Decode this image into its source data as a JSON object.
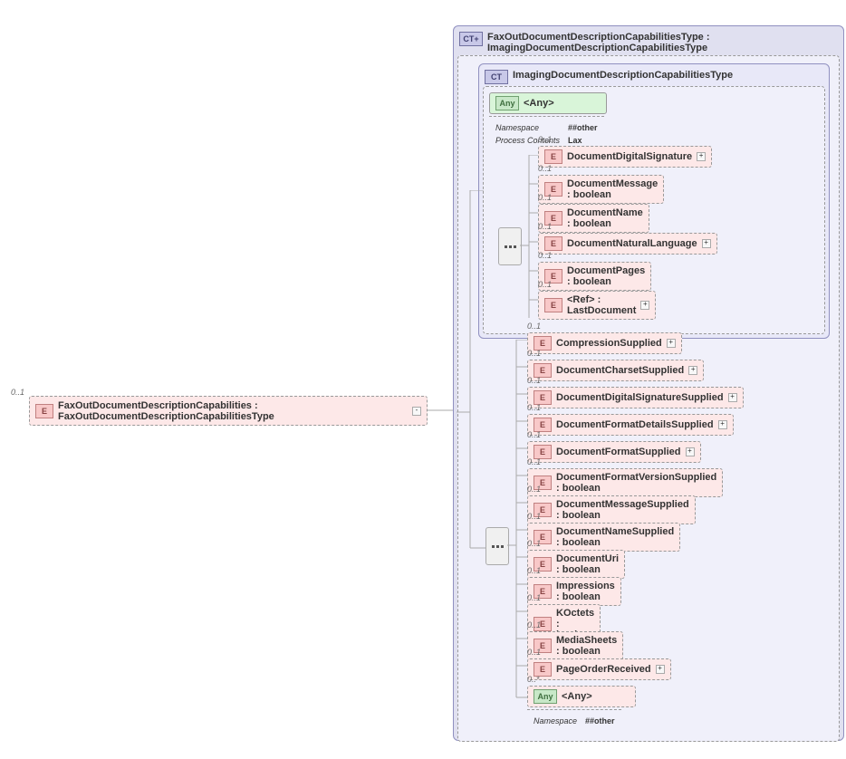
{
  "root": {
    "cardinality": "0..1",
    "element_name": "FaxOutDocumentDescriptionCapabilities",
    "element_type": "FaxOutDocumentDescriptionCapabilitiesType"
  },
  "outer_ct": {
    "name": "FaxOutDocumentDescriptionCapabilitiesType",
    "base": "ImagingDocumentDescriptionCapabilitiesType"
  },
  "inner_ct": {
    "name": "ImagingDocumentDescriptionCapabilitiesType"
  },
  "any_top": {
    "label": "<Any>",
    "namespace_label": "Namespace",
    "namespace_val": "##other",
    "process_label": "Process Contents",
    "process_val": "Lax"
  },
  "inner_elements": [
    {
      "card": "0..1",
      "label": "DocumentDigitalSignature",
      "expand": true
    },
    {
      "card": "0..1",
      "label": "DocumentMessage : boolean"
    },
    {
      "card": "0..1",
      "label": "DocumentName : boolean"
    },
    {
      "card": "0..1",
      "label": "DocumentNaturalLanguage",
      "expand": true
    },
    {
      "card": "0..1",
      "label": "DocumentPages : boolean"
    },
    {
      "card": "0..1",
      "label": "<Ref>    : LastDocument",
      "expand": true
    }
  ],
  "outer_elements": [
    {
      "card": "0..1",
      "label": "CompressionSupplied",
      "expand": true
    },
    {
      "card": "0..1",
      "label": "DocumentCharsetSupplied",
      "expand": true
    },
    {
      "card": "0..1",
      "label": "DocumentDigitalSignatureSupplied",
      "expand": true
    },
    {
      "card": "0..1",
      "label": "DocumentFormatDetailsSupplied",
      "expand": true
    },
    {
      "card": "0..1",
      "label": "DocumentFormatSupplied",
      "expand": true
    },
    {
      "card": "0..1",
      "label": "DocumentFormatVersionSupplied : boolean"
    },
    {
      "card": "0..1",
      "label": "DocumentMessageSupplied : boolean"
    },
    {
      "card": "0..1",
      "label": "DocumentNameSupplied : boolean"
    },
    {
      "card": "0..1",
      "label": "DocumentUri : boolean"
    },
    {
      "card": "0..1",
      "label": "Impressions : boolean"
    },
    {
      "card": "0..1",
      "label": "KOctets  : boolean"
    },
    {
      "card": "0..1",
      "label": "MediaSheets : boolean"
    },
    {
      "card": "0..1",
      "label": "PageOrderReceived",
      "expand": true
    }
  ],
  "any_bottom": {
    "card": "0..*",
    "label": "<Any>",
    "namespace_label": "Namespace",
    "namespace_val": "##other"
  }
}
